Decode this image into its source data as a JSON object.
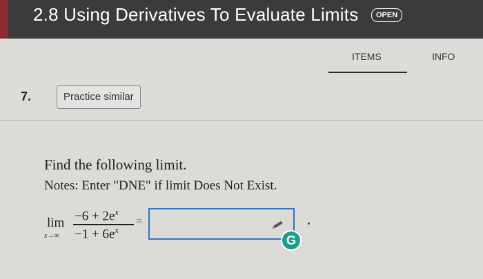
{
  "header": {
    "title": "2.8 Using Derivatives To Evaluate Limits",
    "badge": "OPEN"
  },
  "tabs": [
    {
      "label": "ITEMS",
      "active": true
    },
    {
      "label": "INFO",
      "active": false
    }
  ],
  "question": {
    "number": "7.",
    "practice_label": "Practice similar",
    "prompt": "Find the following limit.",
    "notes": "Notes: Enter \"DNE\" if limit Does Not Exist.",
    "limit_word": "lim",
    "limit_sub": "x→∞",
    "numerator_base": "−6 + 2e",
    "numerator_exp": "x",
    "denominator_base": "−1 + 6e",
    "denominator_exp": "x",
    "equals": "=",
    "answer_value": "",
    "grammar_badge": "G"
  },
  "colors": {
    "header_bg": "#3d3a3c",
    "accent": "#8b2b2f",
    "input_border": "#2f74c9",
    "badge_green": "#1e9e8a"
  }
}
